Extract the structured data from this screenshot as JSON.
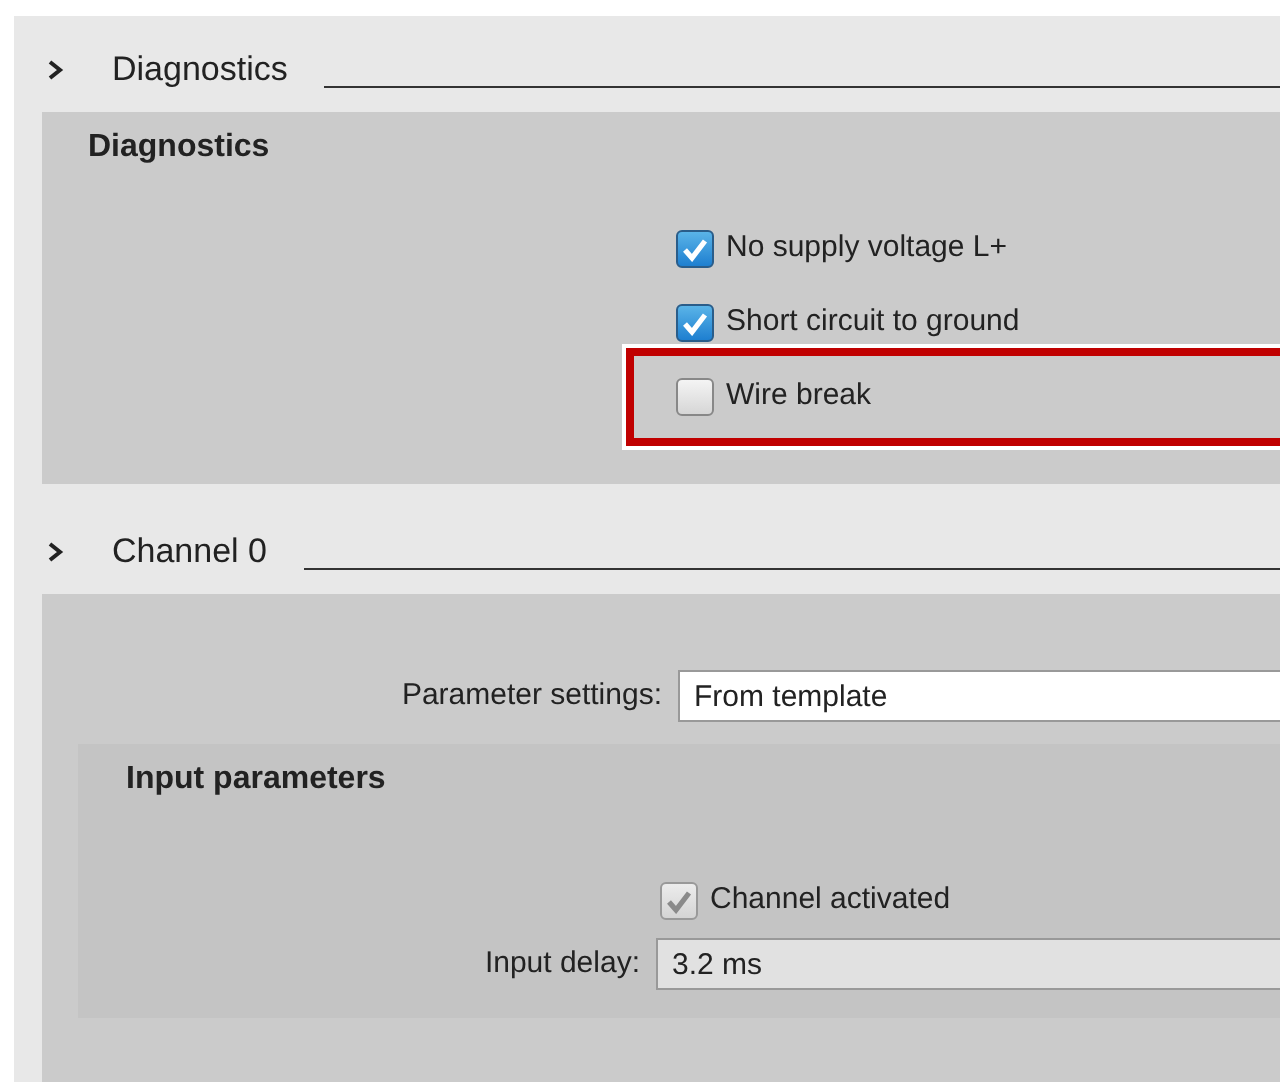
{
  "diagnostics_section": {
    "header": "Diagnostics",
    "group": {
      "title": "Diagnostics",
      "options": [
        {
          "label": "No supply voltage L+",
          "checked": true,
          "disabled": false,
          "highlighted": false
        },
        {
          "label": "Short circuit to ground",
          "checked": true,
          "disabled": false,
          "highlighted": false
        },
        {
          "label": "Wire break",
          "checked": false,
          "disabled": false,
          "highlighted": true
        }
      ]
    }
  },
  "channel_section": {
    "header": "Channel 0",
    "fields": [
      {
        "label": "Parameter settings:",
        "value": "From template",
        "disabled": false
      }
    ],
    "subgroup": {
      "title": "Input parameters",
      "options": [
        {
          "label": "Channel activated",
          "checked": true,
          "disabled": true
        }
      ],
      "fields": [
        {
          "label": "Input delay:",
          "value": "3.2 ms",
          "disabled": true
        }
      ]
    }
  }
}
